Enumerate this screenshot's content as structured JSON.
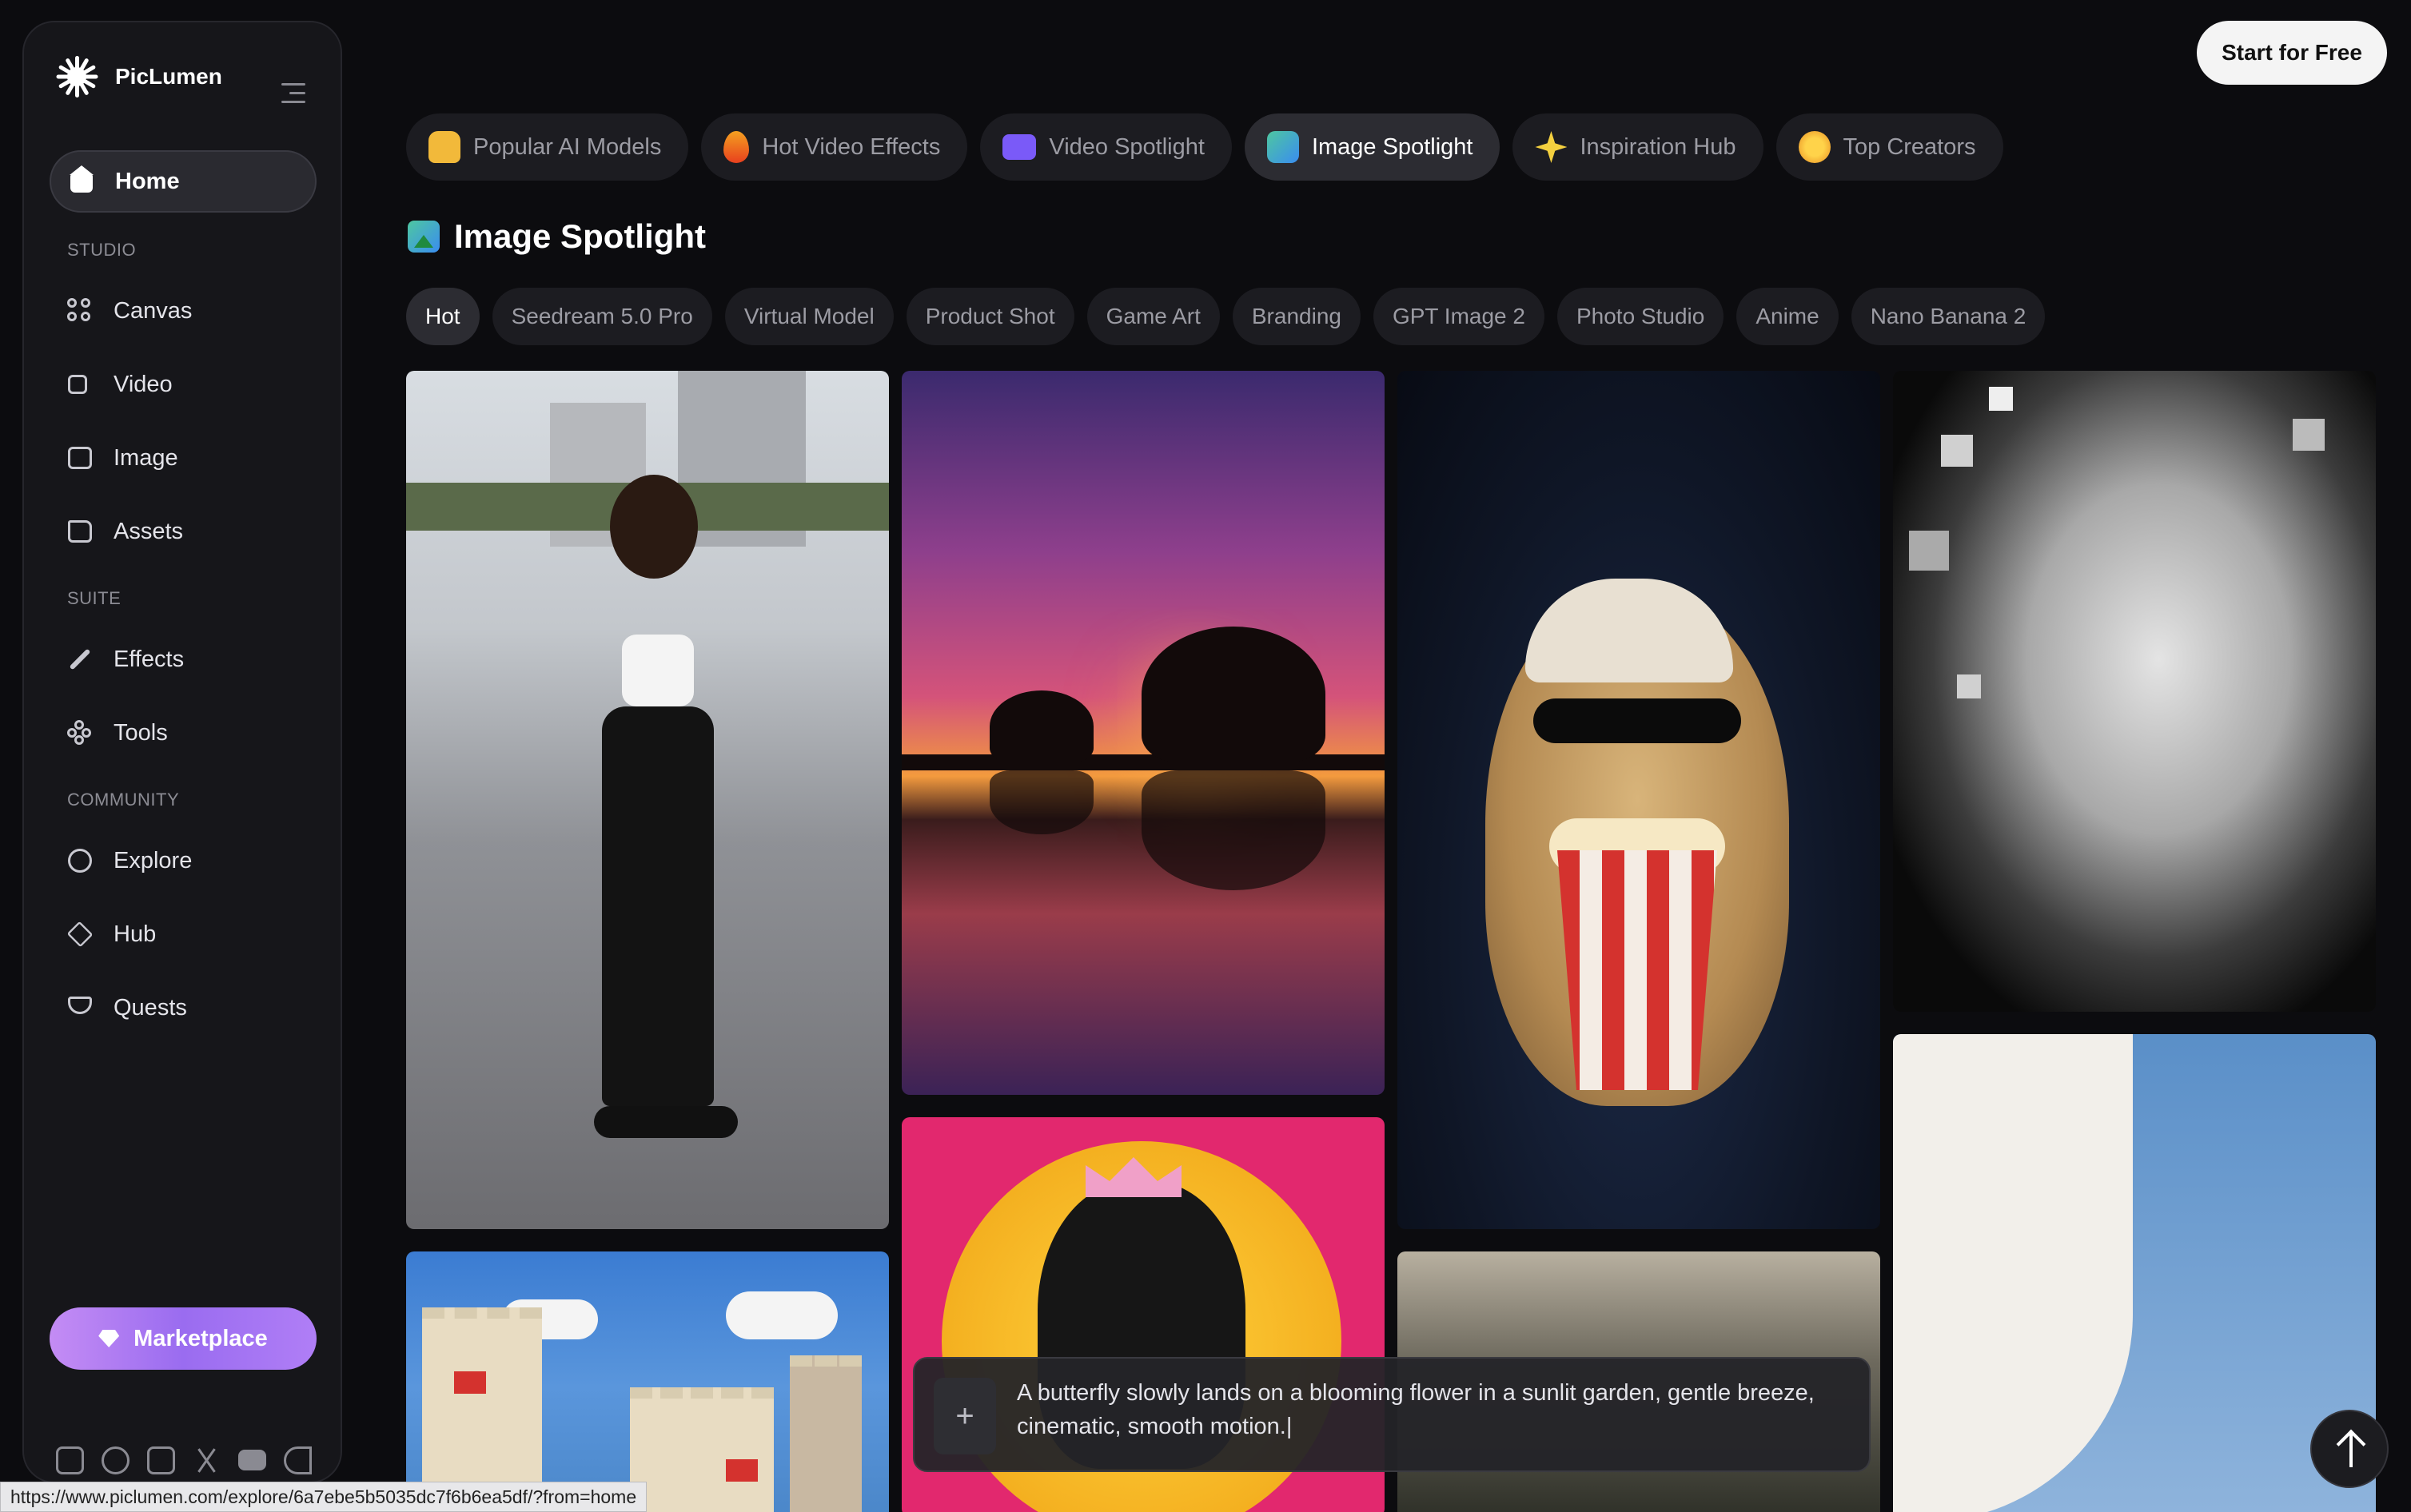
{
  "app": {
    "name": "PicLumen"
  },
  "sidebar": {
    "home_label": "Home",
    "studio_label": "STUDIO",
    "studio_items": [
      {
        "label": "Canvas",
        "icon": "canvas-icon"
      },
      {
        "label": "Video",
        "icon": "video-icon"
      },
      {
        "label": "Image",
        "icon": "image-icon"
      },
      {
        "label": "Assets",
        "icon": "assets-icon"
      }
    ],
    "suite_label": "SUITE",
    "suite_items": [
      {
        "label": "Effects",
        "icon": "effects-icon"
      },
      {
        "label": "Tools",
        "icon": "tools-icon"
      }
    ],
    "community_label": "COMMUNITY",
    "community_items": [
      {
        "label": "Explore",
        "icon": "compass-icon"
      },
      {
        "label": "Hub",
        "icon": "graduation-cap-icon"
      },
      {
        "label": "Quests",
        "icon": "trophy-icon"
      }
    ],
    "marketplace_label": "Marketplace",
    "social_icons": [
      "discord-icon",
      "facebook-icon",
      "instagram-icon",
      "x-icon",
      "youtube-icon",
      "tiktok-icon"
    ]
  },
  "header": {
    "start_label": "Start for Free"
  },
  "top_tabs": [
    {
      "label": "Popular AI Models",
      "active": false,
      "color": "#f2b93a"
    },
    {
      "label": "Hot Video Effects",
      "active": false,
      "color": "#f05a28"
    },
    {
      "label": "Video Spotlight",
      "active": false,
      "color": "#7a5af8"
    },
    {
      "label": "Image Spotlight",
      "active": true,
      "color": "#3fb47a"
    },
    {
      "label": "Inspiration Hub",
      "active": false,
      "color": "#f4d03f"
    },
    {
      "label": "Top Creators",
      "active": false,
      "color": "#f0a030"
    }
  ],
  "section": {
    "title": "Image Spotlight"
  },
  "filters": [
    "Hot",
    "Seedream 5.0 Pro",
    "Virtual Model",
    "Product Shot",
    "Game Art",
    "Branding",
    "GPT Image 2",
    "Photo Studio",
    "Anime",
    "Nano Banana 2"
  ],
  "prompt": {
    "text": "A butterfly slowly lands on a blooming flower in a sunlit garden, gentle breeze, cinematic, smooth motion.|"
  },
  "status_url": "https://www.piclumen.com/explore/6a7ebe5b5035dc7f6b6ea5df/?from=home",
  "colors": {
    "accent": "#a878f2",
    "background": "#0c0c0f"
  }
}
